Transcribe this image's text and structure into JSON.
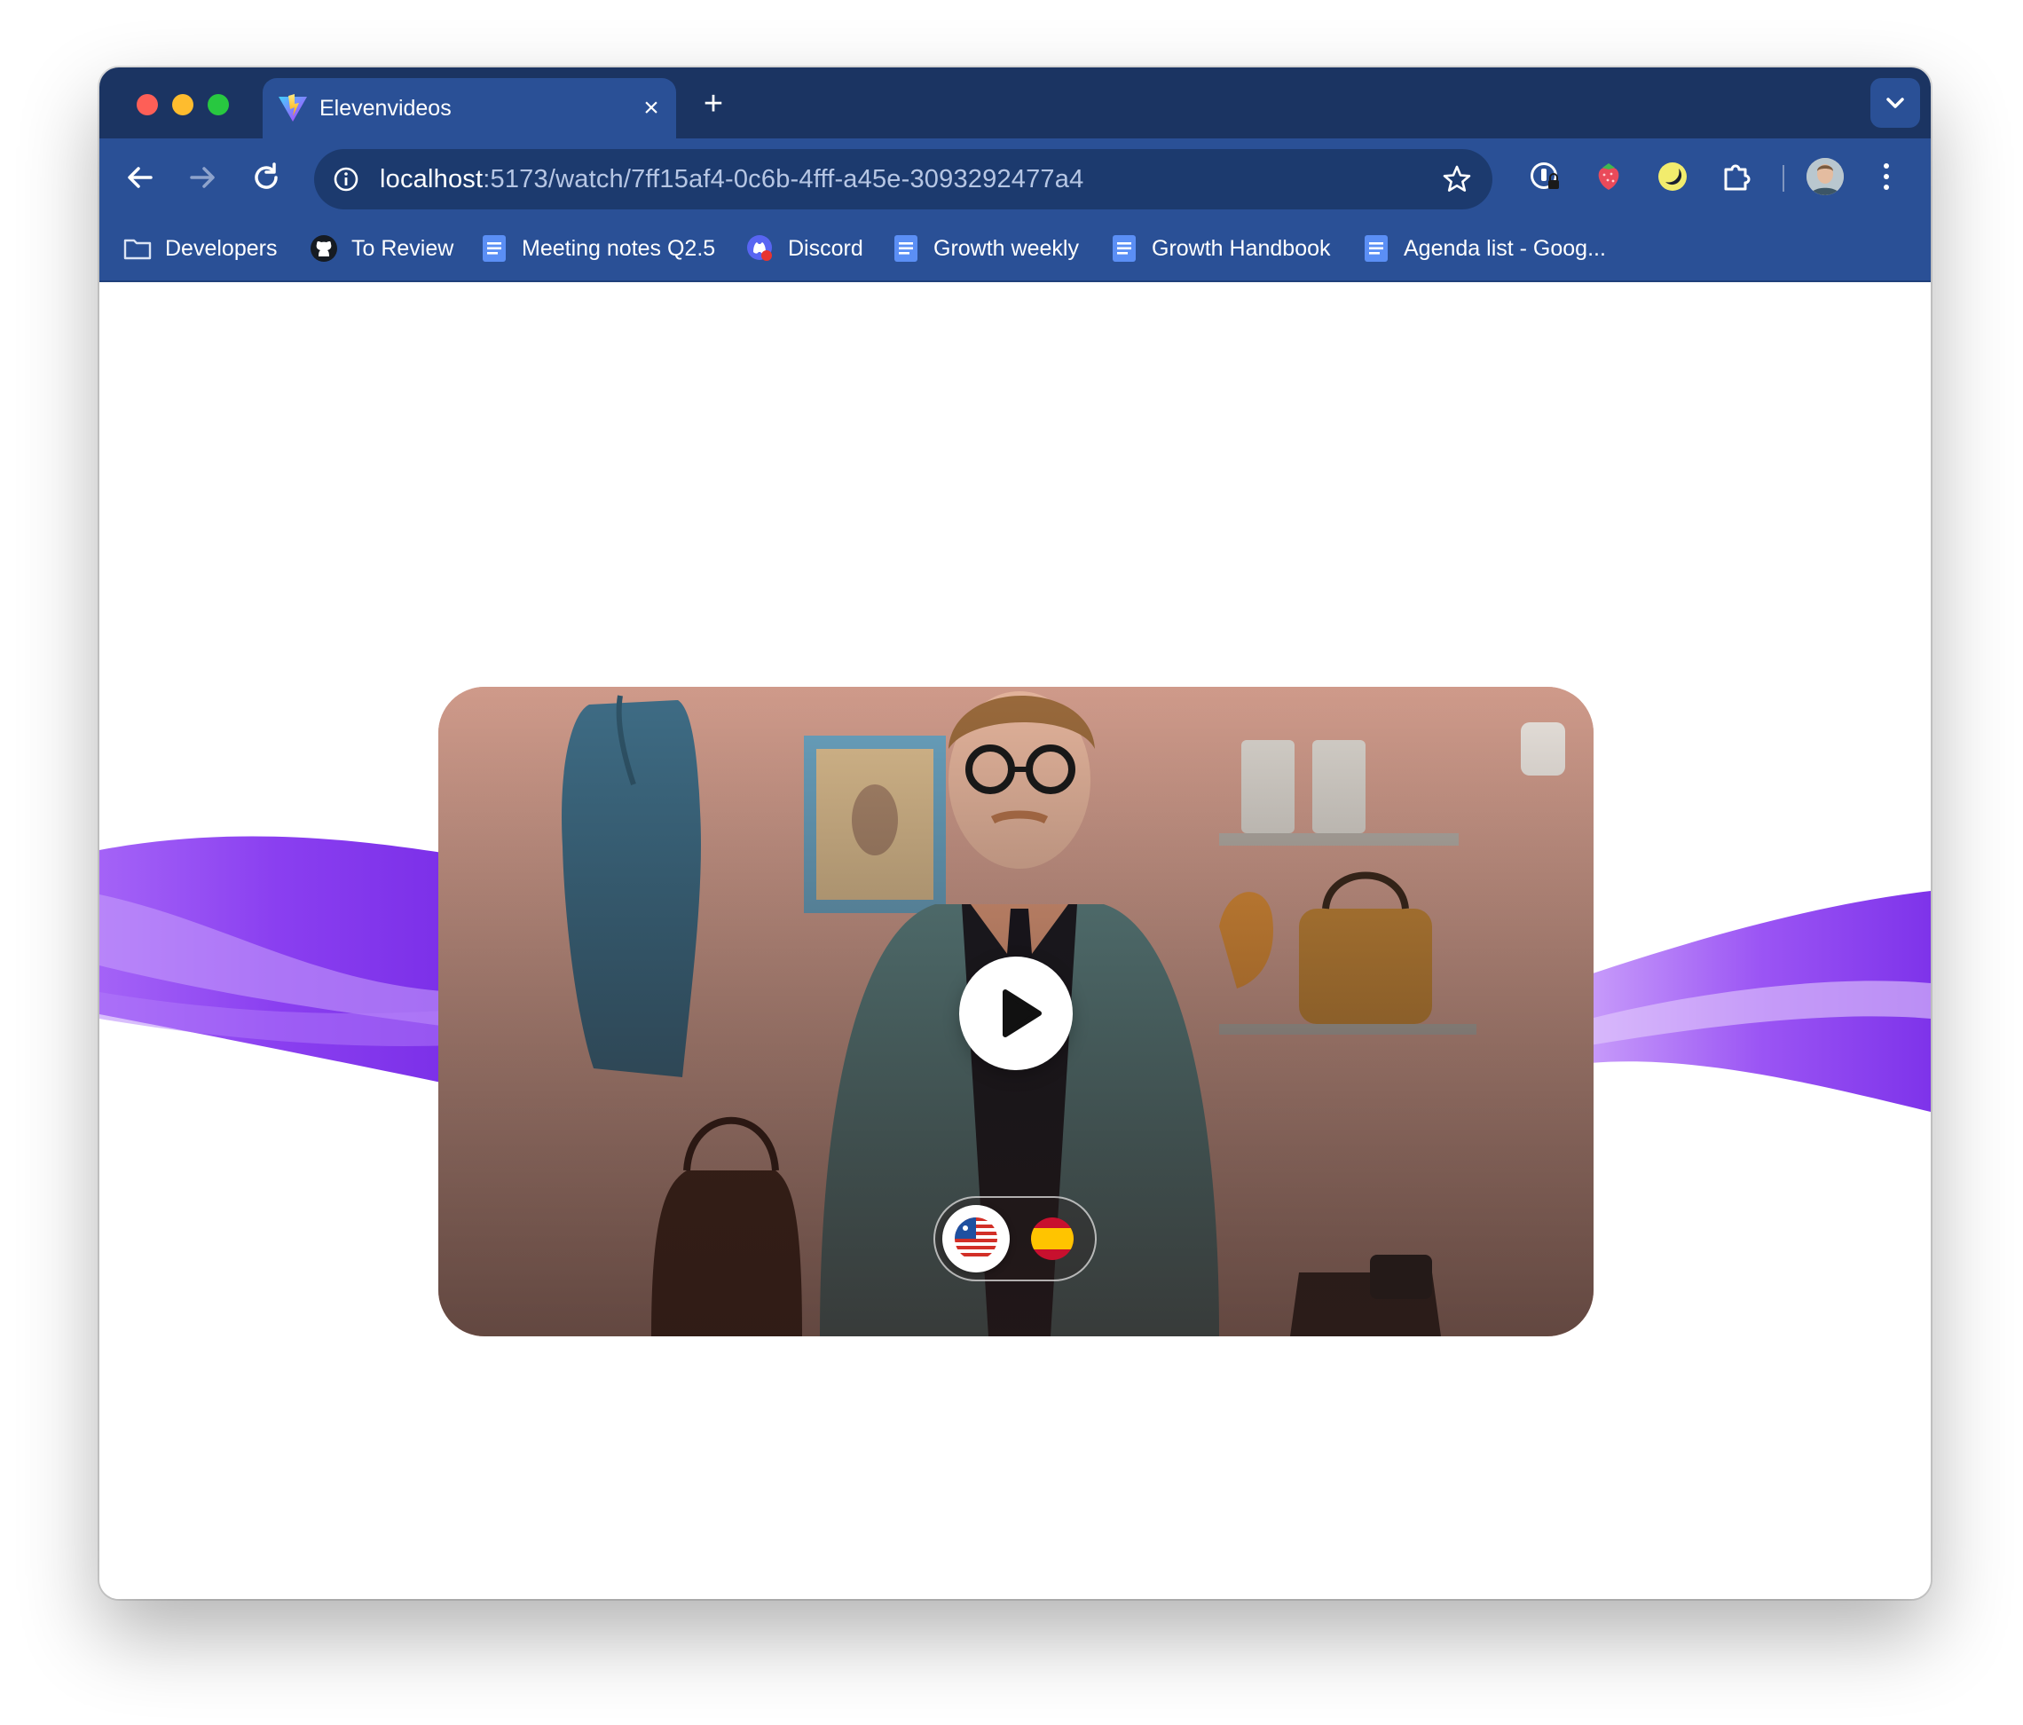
{
  "browser": {
    "tab": {
      "title": "Elevenvideos",
      "favicon": "vite-logo-icon",
      "close_icon": "×"
    },
    "new_tab_icon": "+",
    "toolbar": {
      "url_host": "localhost",
      "url_path": ":5173/watch/7ff15af4-0c6b-4fff-a45e-3093292477a4",
      "extensions": [
        "password-manager-icon",
        "strawberry-icon",
        "night-mode-icon",
        "puzzle-extensions-icon"
      ]
    },
    "bookmarks": [
      {
        "label": "Developers",
        "icon": "folder-icon"
      },
      {
        "label": "To Review",
        "icon": "github-icon"
      },
      {
        "label": "Meeting notes Q2.5",
        "icon": "google-doc-icon"
      },
      {
        "label": "Discord",
        "icon": "discord-icon"
      },
      {
        "label": "Growth weekly",
        "icon": "google-doc-icon"
      },
      {
        "label": "Growth Handbook",
        "icon": "google-doc-icon"
      },
      {
        "label": "Agenda list - Goog...",
        "icon": "google-doc-icon"
      }
    ]
  },
  "player": {
    "play_icon": "play-icon",
    "languages": [
      {
        "flag": "us-flag-icon",
        "selected": true
      },
      {
        "flag": "spain-flag-icon",
        "selected": false
      }
    ]
  },
  "colors": {
    "tabstrip": "#1b3462",
    "toolbar": "#2a5096",
    "accent_purple": "#8a3ff0"
  }
}
